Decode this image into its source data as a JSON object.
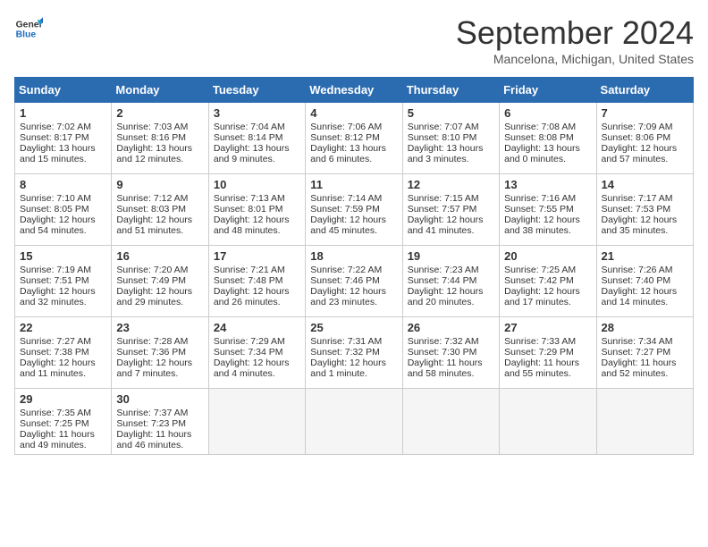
{
  "header": {
    "logo_line1": "General",
    "logo_line2": "Blue",
    "month": "September 2024",
    "location": "Mancelona, Michigan, United States"
  },
  "days_of_week": [
    "Sunday",
    "Monday",
    "Tuesday",
    "Wednesday",
    "Thursday",
    "Friday",
    "Saturday"
  ],
  "weeks": [
    [
      {
        "day": 1,
        "sunrise": "7:02 AM",
        "sunset": "8:17 PM",
        "daylight": "13 hours and 15 minutes."
      },
      {
        "day": 2,
        "sunrise": "7:03 AM",
        "sunset": "8:16 PM",
        "daylight": "13 hours and 12 minutes."
      },
      {
        "day": 3,
        "sunrise": "7:04 AM",
        "sunset": "8:14 PM",
        "daylight": "13 hours and 9 minutes."
      },
      {
        "day": 4,
        "sunrise": "7:06 AM",
        "sunset": "8:12 PM",
        "daylight": "13 hours and 6 minutes."
      },
      {
        "day": 5,
        "sunrise": "7:07 AM",
        "sunset": "8:10 PM",
        "daylight": "13 hours and 3 minutes."
      },
      {
        "day": 6,
        "sunrise": "7:08 AM",
        "sunset": "8:08 PM",
        "daylight": "13 hours and 0 minutes."
      },
      {
        "day": 7,
        "sunrise": "7:09 AM",
        "sunset": "8:06 PM",
        "daylight": "12 hours and 57 minutes."
      }
    ],
    [
      {
        "day": 8,
        "sunrise": "7:10 AM",
        "sunset": "8:05 PM",
        "daylight": "12 hours and 54 minutes."
      },
      {
        "day": 9,
        "sunrise": "7:12 AM",
        "sunset": "8:03 PM",
        "daylight": "12 hours and 51 minutes."
      },
      {
        "day": 10,
        "sunrise": "7:13 AM",
        "sunset": "8:01 PM",
        "daylight": "12 hours and 48 minutes."
      },
      {
        "day": 11,
        "sunrise": "7:14 AM",
        "sunset": "7:59 PM",
        "daylight": "12 hours and 45 minutes."
      },
      {
        "day": 12,
        "sunrise": "7:15 AM",
        "sunset": "7:57 PM",
        "daylight": "12 hours and 41 minutes."
      },
      {
        "day": 13,
        "sunrise": "7:16 AM",
        "sunset": "7:55 PM",
        "daylight": "12 hours and 38 minutes."
      },
      {
        "day": 14,
        "sunrise": "7:17 AM",
        "sunset": "7:53 PM",
        "daylight": "12 hours and 35 minutes."
      }
    ],
    [
      {
        "day": 15,
        "sunrise": "7:19 AM",
        "sunset": "7:51 PM",
        "daylight": "12 hours and 32 minutes."
      },
      {
        "day": 16,
        "sunrise": "7:20 AM",
        "sunset": "7:49 PM",
        "daylight": "12 hours and 29 minutes."
      },
      {
        "day": 17,
        "sunrise": "7:21 AM",
        "sunset": "7:48 PM",
        "daylight": "12 hours and 26 minutes."
      },
      {
        "day": 18,
        "sunrise": "7:22 AM",
        "sunset": "7:46 PM",
        "daylight": "12 hours and 23 minutes."
      },
      {
        "day": 19,
        "sunrise": "7:23 AM",
        "sunset": "7:44 PM",
        "daylight": "12 hours and 20 minutes."
      },
      {
        "day": 20,
        "sunrise": "7:25 AM",
        "sunset": "7:42 PM",
        "daylight": "12 hours and 17 minutes."
      },
      {
        "day": 21,
        "sunrise": "7:26 AM",
        "sunset": "7:40 PM",
        "daylight": "12 hours and 14 minutes."
      }
    ],
    [
      {
        "day": 22,
        "sunrise": "7:27 AM",
        "sunset": "7:38 PM",
        "daylight": "12 hours and 11 minutes."
      },
      {
        "day": 23,
        "sunrise": "7:28 AM",
        "sunset": "7:36 PM",
        "daylight": "12 hours and 7 minutes."
      },
      {
        "day": 24,
        "sunrise": "7:29 AM",
        "sunset": "7:34 PM",
        "daylight": "12 hours and 4 minutes."
      },
      {
        "day": 25,
        "sunrise": "7:31 AM",
        "sunset": "7:32 PM",
        "daylight": "12 hours and 1 minute."
      },
      {
        "day": 26,
        "sunrise": "7:32 AM",
        "sunset": "7:30 PM",
        "daylight": "11 hours and 58 minutes."
      },
      {
        "day": 27,
        "sunrise": "7:33 AM",
        "sunset": "7:29 PM",
        "daylight": "11 hours and 55 minutes."
      },
      {
        "day": 28,
        "sunrise": "7:34 AM",
        "sunset": "7:27 PM",
        "daylight": "11 hours and 52 minutes."
      }
    ],
    [
      {
        "day": 29,
        "sunrise": "7:35 AM",
        "sunset": "7:25 PM",
        "daylight": "11 hours and 49 minutes."
      },
      {
        "day": 30,
        "sunrise": "7:37 AM",
        "sunset": "7:23 PM",
        "daylight": "11 hours and 46 minutes."
      },
      null,
      null,
      null,
      null,
      null
    ]
  ]
}
